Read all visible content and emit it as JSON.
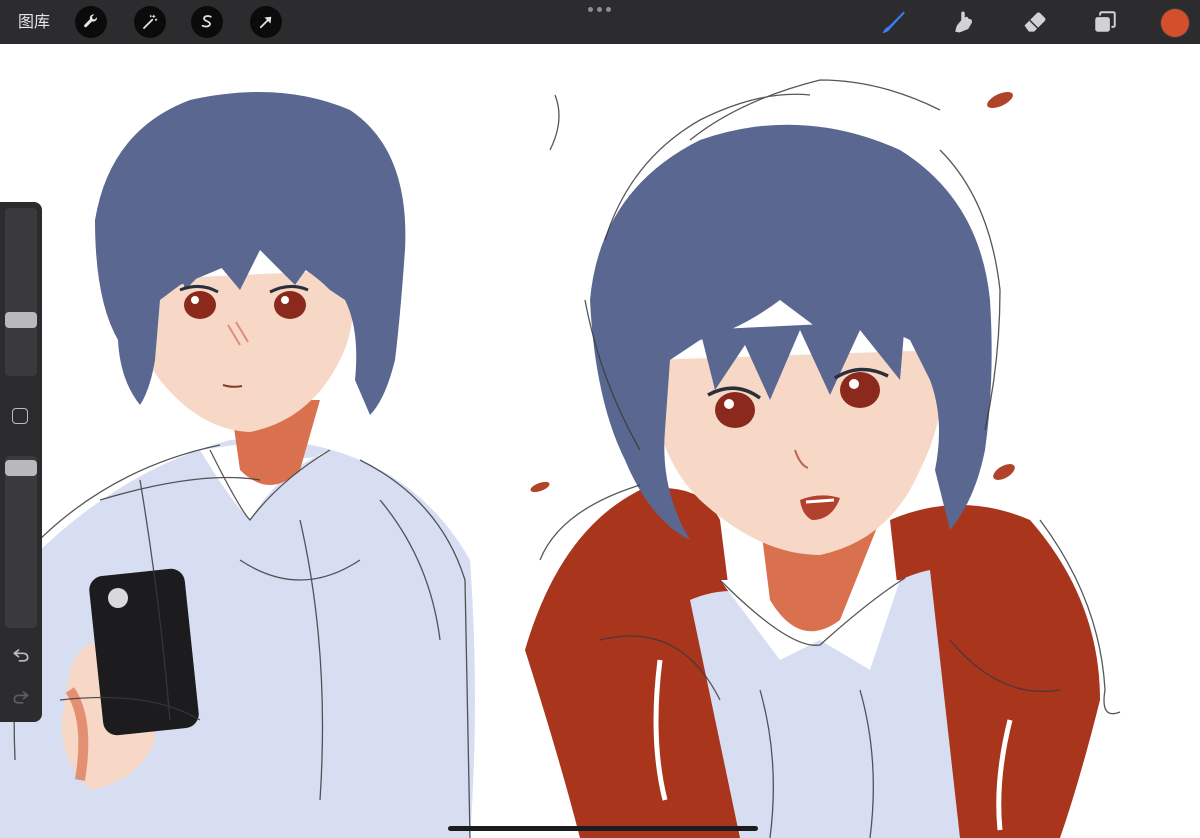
{
  "topbar": {
    "gallery_label": "图库",
    "left_tools": [
      "wrench-icon",
      "magic-wand-icon",
      "selection-icon",
      "transform-arrow-icon"
    ],
    "right_tools": [
      "brush-icon",
      "smudge-icon",
      "eraser-icon",
      "layers-icon"
    ],
    "active_tool": "brush-icon",
    "current_color": "#d4502c"
  },
  "sidebar": {
    "brush_size": 0.7,
    "opacity": 1.0,
    "controls": [
      "modify-button-icon",
      "undo-icon",
      "redo-icon"
    ]
  },
  "colors": {
    "hair": "#5a6891",
    "skin": "#f7d8c6",
    "shirt": "#d7def2",
    "jacket": "#a8351c",
    "sketch": "#3a3a3c"
  }
}
